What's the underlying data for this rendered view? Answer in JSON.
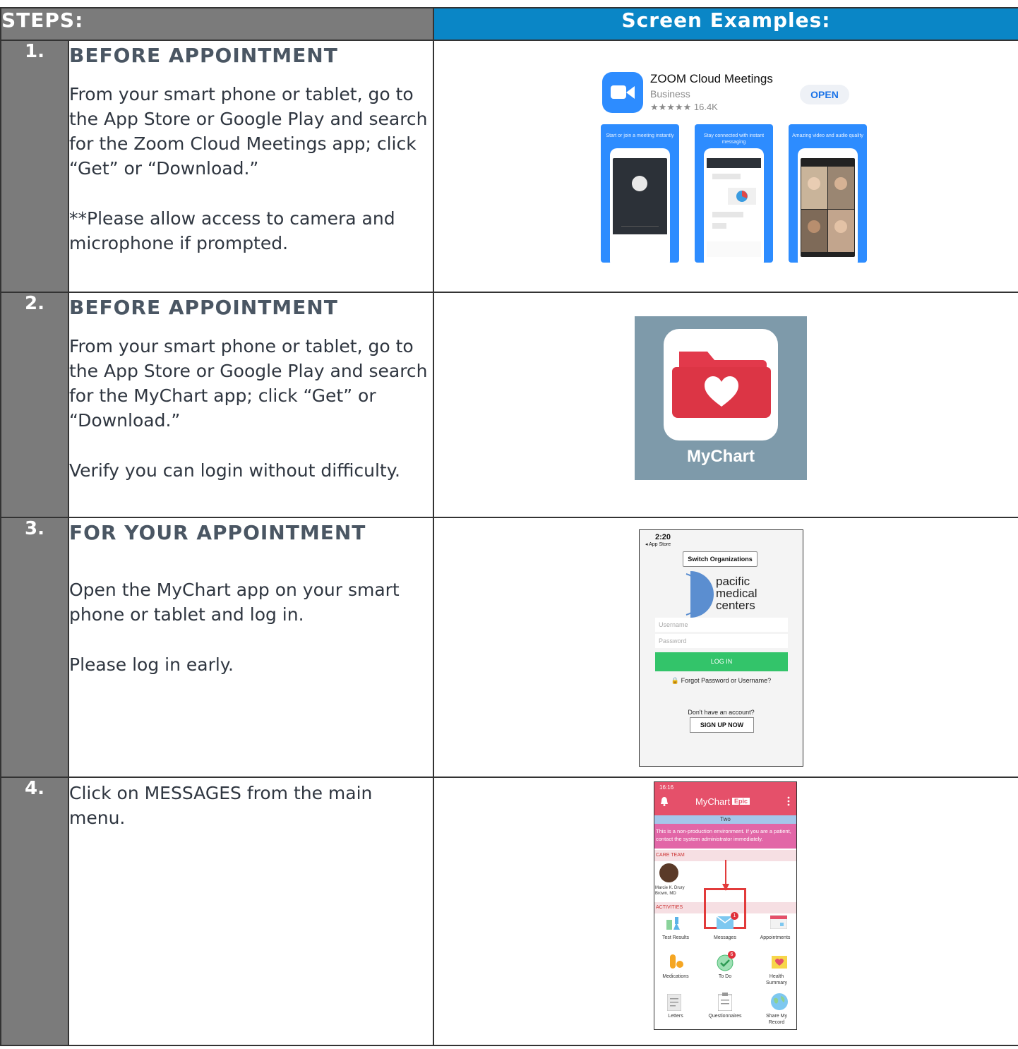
{
  "header": {
    "steps_label": "STEPS:",
    "screens_label": "Screen Examples:"
  },
  "steps": [
    {
      "number": "1.",
      "title": "BEFORE APPOINTMENT",
      "paragraphs": [
        "From your smart phone or tablet, go to the App Store or Google Play and search for the Zoom Cloud Meetings app; click “Get” or “Download.”",
        "**Please allow access to camera and microphone if prompted."
      ]
    },
    {
      "number": "2.",
      "title": "BEFORE APPOINTMENT",
      "paragraphs": [
        "From your smart phone or tablet, go to the App Store or Google Play and search for the MyChart app; click “Get” or “Download.”",
        "Verify you can login without difficulty."
      ]
    },
    {
      "number": "3.",
      "title": "FOR YOUR APPOINTMENT",
      "paragraphs": [
        "Open the MyChart app on your smart phone or tablet and log in.",
        "Please log in early."
      ]
    },
    {
      "number": "4.",
      "title": "",
      "paragraphs": [
        "Click on MESSAGES from the main menu."
      ]
    }
  ],
  "zoom_listing": {
    "app_name": "ZOOM Cloud Meetings",
    "category": "Business",
    "rating": "★★★★★ 16.4K",
    "open_label": "OPEN",
    "panel_captions": [
      "Start or join a meeting instantly",
      "Stay connected with instant messaging",
      "Amazing video and audio quality"
    ],
    "brand_color": "#2d8cff"
  },
  "mychart_logo": {
    "label": "MyChart",
    "folder_color": "#dc3545",
    "background": "#7e9aaa"
  },
  "login_screen": {
    "time": "2:20",
    "back_label": "◂ App Store",
    "switch_label": "Switch Organizations",
    "org_name": [
      "pacific",
      "medical",
      "centers"
    ],
    "username_placeholder": "Username",
    "password_placeholder": "Password",
    "login_label": "LOG IN",
    "forgot_label": "Forgot Password or Username?",
    "no_account": "Don't have an account?",
    "signup_label": "SIGN UP NOW"
  },
  "messages_screen": {
    "time": "16:16",
    "brand": "MyChart",
    "epic": "Epic",
    "patient": "Two",
    "warning": "This is a non-production environment. If you are a patient, contact the system administrator immediately.",
    "care_team_label": "CARE TEAM",
    "doctor": "Marcie K. Drury Brown, MD",
    "activities_label": "ACTIVITIES",
    "tiles": [
      "Test Results",
      "Messages",
      "Appointments",
      "Medications",
      "To Do",
      "Health Summary",
      "Letters",
      "Questionnaires",
      "Share My Record"
    ],
    "message_badge": "1",
    "todo_badge": "6"
  }
}
